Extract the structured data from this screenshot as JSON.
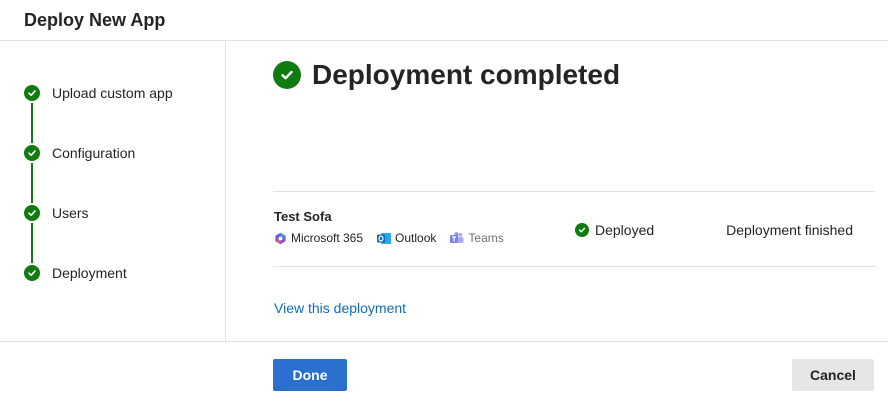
{
  "header": {
    "title": "Deploy New App"
  },
  "steps": [
    {
      "label": "Upload custom app",
      "status": "complete",
      "icon": "check-circle-icon"
    },
    {
      "label": "Configuration",
      "status": "complete",
      "icon": "check-circle-icon"
    },
    {
      "label": "Users",
      "status": "complete",
      "icon": "check-circle-icon"
    },
    {
      "label": "Deployment",
      "status": "complete",
      "icon": "check-circle-icon"
    }
  ],
  "main": {
    "title": "Deployment completed",
    "deployment": {
      "app_name": "Test Sofa",
      "hosts": [
        {
          "label": "Microsoft 365",
          "icon": "microsoft-365-icon"
        },
        {
          "label": "Outlook",
          "icon": "outlook-icon"
        },
        {
          "label": "Teams",
          "icon": "teams-icon"
        }
      ],
      "status": "Deployed",
      "status_detail": "Deployment finished"
    },
    "view_link": "View this deployment"
  },
  "footer": {
    "done_label": "Done",
    "cancel_label": "Cancel"
  },
  "colors": {
    "success": "#107c10",
    "primary": "#2b6fcf",
    "link": "#0f6cbd",
    "outlook": "#0f6cbd",
    "teams": "#7b83eb"
  }
}
